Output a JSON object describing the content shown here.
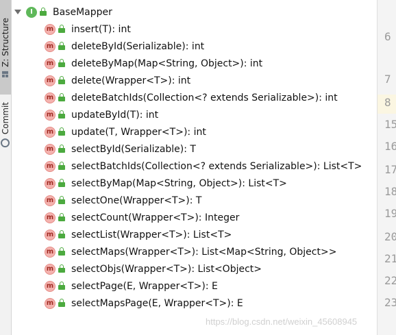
{
  "sidebar": {
    "tabs": [
      {
        "label": "Z: Structure",
        "icon": "structure-icon"
      },
      {
        "label": "Commit",
        "icon": "commit-icon"
      }
    ]
  },
  "tree": {
    "root": {
      "badge": "I",
      "label": "BaseMapper"
    },
    "method_badge": "m",
    "methods": [
      "insert(T): int",
      "deleteById(Serializable): int",
      "deleteByMap(Map<String, Object>): int",
      "delete(Wrapper<T>): int",
      "deleteBatchIds(Collection<? extends Serializable>): int",
      "updateById(T): int",
      "update(T, Wrapper<T>): int",
      "selectById(Serializable): T",
      "selectBatchIds(Collection<? extends Serializable>): List<T>",
      "selectByMap(Map<String, Object>): List<T>",
      "selectOne(Wrapper<T>): T",
      "selectCount(Wrapper<T>): Integer",
      "selectList(Wrapper<T>): List<T>",
      "selectMaps(Wrapper<T>): List<Map<String, Object>>",
      "selectObjs(Wrapper<T>): List<Object>",
      "selectPage(E, Wrapper<T>): E",
      "selectMapsPage(E, Wrapper<T>): E"
    ]
  },
  "gutter": {
    "line_numbers": [
      "6",
      "7",
      "8",
      "15",
      "16",
      "17",
      "18",
      "19",
      "20",
      "21",
      "22",
      "23"
    ]
  },
  "watermark": "https://blog.csdn.net/weixin_45608945",
  "colors": {
    "interface_badge": "#5fb85a",
    "method_badge": "#f4b2ae",
    "lock": "#4caa3f"
  }
}
